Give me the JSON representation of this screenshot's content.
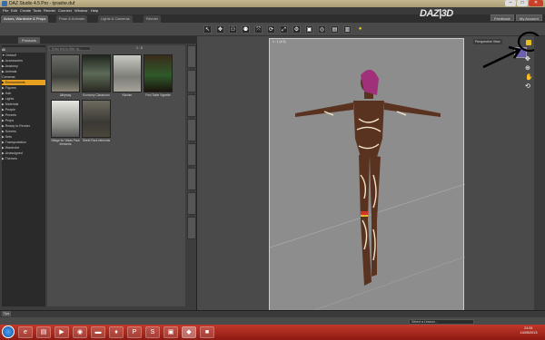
{
  "window": {
    "title": "DAZ Studio 4.5 Pro - tyrashe.duf"
  },
  "menu": [
    "File",
    "Edit",
    "Create",
    "Tools",
    "Render",
    "Connect",
    "Window",
    "Help"
  ],
  "workspace_tabs": [
    {
      "label": "Actors, Wardrobe & Props",
      "active": true
    },
    {
      "label": "Pose & Animate",
      "active": false
    },
    {
      "label": "Lights & Cameras",
      "active": false
    },
    {
      "label": "Render",
      "active": false
    }
  ],
  "brand": {
    "logo": "DAZ|3D"
  },
  "top_buttons": {
    "feedback": "Feedback",
    "my_account": "My Account"
  },
  "panel": {
    "tab_products": "Products",
    "search_placeholder": "Enter text to filter by...",
    "pager": "1 - 8"
  },
  "categories": [
    {
      "label": "All",
      "state": "hdr"
    },
    {
      "label": "▼ Default",
      "state": "normal"
    },
    {
      "label": "  ▶ Accessories",
      "state": "normal"
    },
    {
      "label": "  ▶ Anatomy",
      "state": "normal"
    },
    {
      "label": "  ▶ Animals",
      "state": "normal"
    },
    {
      "label": "    Cameras",
      "state": "normal"
    },
    {
      "label": "  ▶ Environments",
      "state": "sel"
    },
    {
      "label": "  ▶ Figures",
      "state": "normal"
    },
    {
      "label": "  ▶ Hair",
      "state": "normal"
    },
    {
      "label": "  ▶ Lights",
      "state": "normal"
    },
    {
      "label": "  ▶ Materials",
      "state": "normal"
    },
    {
      "label": "  ▶ People",
      "state": "normal"
    },
    {
      "label": "  ▶ Presets",
      "state": "normal"
    },
    {
      "label": "  ▶ Props",
      "state": "normal"
    },
    {
      "label": "  ▶ Ready to Render",
      "state": "normal"
    },
    {
      "label": "  ▶ Scenes",
      "state": "normal"
    },
    {
      "label": "  ▶ Sets",
      "state": "normal"
    },
    {
      "label": "  ▶ Transportation",
      "state": "normal"
    },
    {
      "label": "  ▶ Wardrobe",
      "state": "normal"
    },
    {
      "label": "  ▶ Unassigned",
      "state": "normal"
    },
    {
      "label": "▶ Themes",
      "state": "normal"
    }
  ],
  "products": [
    {
      "label": "Alleyway"
    },
    {
      "label": "Economy Classroom"
    },
    {
      "label": "Kitchen"
    },
    {
      "label": "Pool Table Vignette"
    },
    {
      "label": "Village for Vistas Pack elements"
    },
    {
      "label": "Street Pack elements"
    }
  ],
  "viewport": {
    "label": "1 : 1 (4:3)",
    "view_name": "Perspective View"
  },
  "bottom": {
    "tips": "Tips",
    "lesson": "Select a Lesson..."
  },
  "taskbar": {
    "time": "21:51",
    "date": "14/05/2013",
    "icons": [
      "ie-icon",
      "explorer-icon",
      "media-icon",
      "firefox-icon",
      "folder-icon",
      "app-icon",
      "photoshop-icon",
      "skype-icon",
      "app2-icon",
      "daz-icon",
      "app3-icon"
    ]
  },
  "colors": {
    "selection": "#e8a020",
    "taskbar": "#c0392b"
  }
}
